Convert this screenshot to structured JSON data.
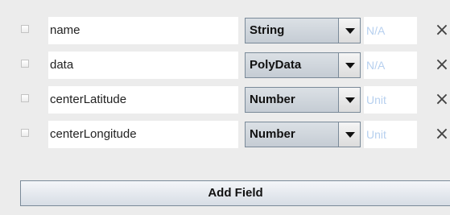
{
  "fields": [
    {
      "name": "name",
      "type": "String",
      "unit": "N/A",
      "remove_icon": "×"
    },
    {
      "name": "data",
      "type": "PolyData",
      "unit": "N/A",
      "remove_icon": "×"
    },
    {
      "name": "centerLatitude",
      "type": "Number",
      "unit": "Unit",
      "remove_icon": "×"
    },
    {
      "name": "centerLongitude",
      "type": "Number",
      "unit": "Unit",
      "remove_icon": "×"
    }
  ],
  "add_field_label": "Add Field",
  "colors": {
    "background": "#ececec",
    "unit_placeholder": "#b7d0ef",
    "button_border": "#7a8a99"
  }
}
